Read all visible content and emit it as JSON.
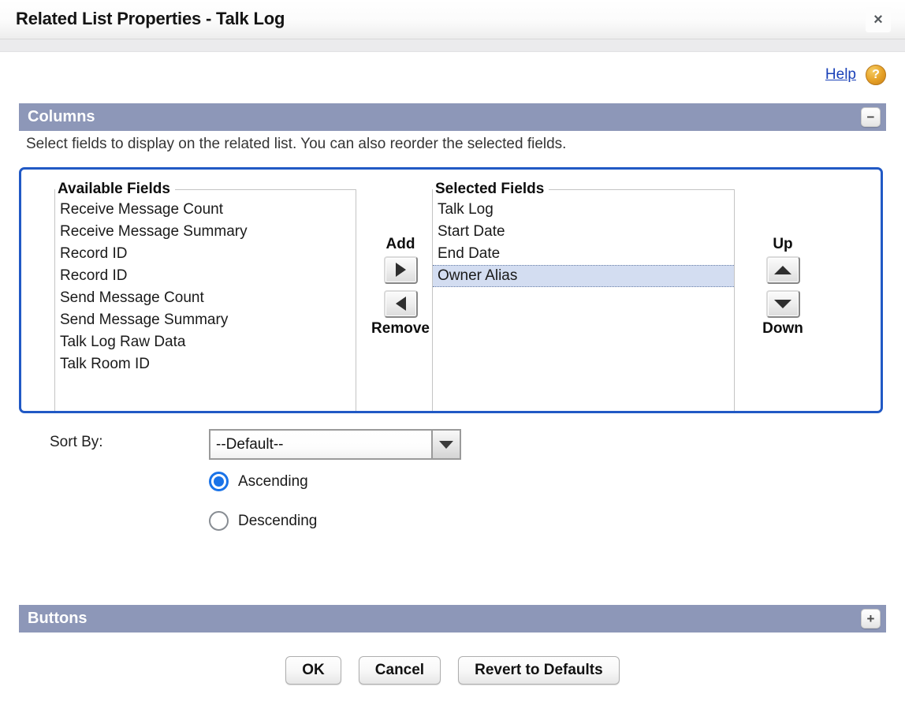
{
  "window": {
    "title": "Related List Properties - Talk Log",
    "close_label": "×"
  },
  "help": {
    "link_label": "Help",
    "icon_label": "?"
  },
  "columns_section": {
    "title": "Columns",
    "toggle_label": "−",
    "description": "Select fields to display on the related list. You can also reorder the selected fields."
  },
  "available": {
    "legend": "Available Fields",
    "items": [
      "Receive Message Count",
      "Receive Message Summary",
      "Record ID",
      "Record ID",
      "Send Message Count",
      "Send Message Summary",
      "Talk Log Raw Data",
      "Talk Room ID"
    ]
  },
  "selected": {
    "legend": "Selected Fields",
    "items": [
      {
        "label": "Talk Log",
        "selected": false
      },
      {
        "label": "Start Date",
        "selected": false
      },
      {
        "label": "End Date",
        "selected": false
      },
      {
        "label": "Owner Alias",
        "selected": true
      }
    ]
  },
  "addremove": {
    "add_label": "Add",
    "remove_label": "Remove"
  },
  "updown": {
    "up_label": "Up",
    "down_label": "Down"
  },
  "sort": {
    "label": "Sort By:",
    "value": "--Default--",
    "options": [
      "--Default--"
    ],
    "ascending_label": "Ascending",
    "descending_label": "Descending",
    "direction": "Ascending"
  },
  "buttons_section": {
    "title": "Buttons",
    "toggle_label": "+"
  },
  "footer": {
    "ok_label": "OK",
    "cancel_label": "Cancel",
    "revert_label": "Revert to Defaults"
  },
  "colors": {
    "section_header_bg": "#8d97b8",
    "picker_border": "#2159c5",
    "link": "#1a41b8",
    "radio_accent": "#1a73e8",
    "selected_row_bg": "#d3ddf1",
    "help_icon": "#e5a026"
  }
}
